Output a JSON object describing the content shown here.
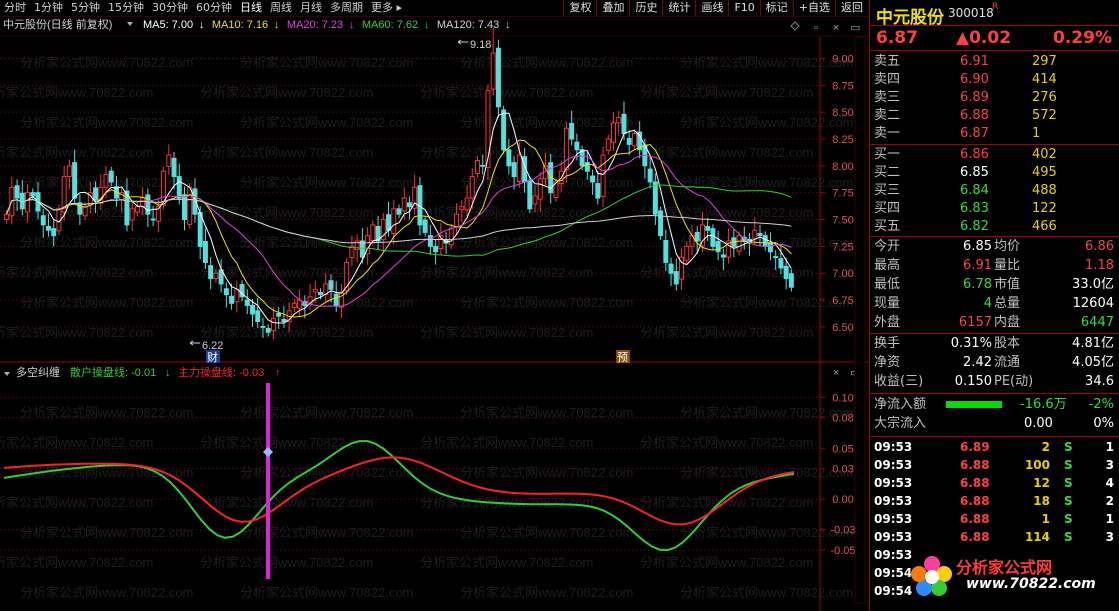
{
  "toolbar": {
    "periods": [
      "分时",
      "1分钟",
      "5分钟",
      "15分钟",
      "30分钟",
      "60分钟",
      "日线",
      "周线",
      "月线",
      "多周期",
      "更多 ▸"
    ],
    "active_period": "日线",
    "buttons": [
      "复权",
      "叠加",
      "历史",
      "统计",
      "画线",
      "F10",
      "标记",
      "+自选",
      "返回"
    ]
  },
  "main_chart": {
    "title": "中元股份(日线 前复权)",
    "ma_legend": [
      {
        "label": "MA5: 7.00",
        "arrow": "↓",
        "color": "#ffffff"
      },
      {
        "label": "MA10: 7.16",
        "arrow": "↓",
        "color": "#f0e000"
      },
      {
        "label": "MA20: 7.23",
        "arrow": "↓",
        "color": "#e040e0"
      },
      {
        "label": "MA60: 7.62",
        "arrow": "↓",
        "color": "#30d030"
      },
      {
        "label": "MA120: 7.43",
        "arrow": "↓",
        "color": "#d0d0d0"
      }
    ],
    "price_ticks": [
      "9.00",
      "8.75",
      "8.50",
      "8.25",
      "8.00",
      "7.75",
      "7.50",
      "7.25",
      "7.00",
      "6.75",
      "6.50"
    ],
    "high_marker": "9.18",
    "low_marker": "6.22",
    "marker_cai": "财",
    "marker_yu": "预",
    "watermark": "分析家公式网www.70822.com"
  },
  "indicator": {
    "title": "多空纠缠",
    "line1_label": "散户操盘线: -0.01",
    "line1_arrow": "↓",
    "line1_color": "#33cc33",
    "line2_label": "主力操盘线: -0.03",
    "line2_arrow": "↑",
    "line2_color": "#ff2020",
    "ticks": [
      "0.10",
      "0.08",
      "0.05",
      "0.03",
      "0.00",
      "-0.03",
      "-0.05"
    ]
  },
  "panel": {
    "name": "中元股份",
    "code": "300018",
    "code_badge": "R",
    "price": "6.87",
    "change": "▲0.02",
    "change_pct": "0.29%",
    "asks": [
      {
        "label": "卖五",
        "price": "6.91",
        "vol": "297"
      },
      {
        "label": "卖四",
        "price": "6.90",
        "vol": "414"
      },
      {
        "label": "卖三",
        "price": "6.89",
        "vol": "276"
      },
      {
        "label": "卖二",
        "price": "6.88",
        "vol": "572"
      },
      {
        "label": "卖一",
        "price": "6.87",
        "vol": "1"
      }
    ],
    "bids": [
      {
        "label": "买一",
        "price": "6.86",
        "vol": "402",
        "pcolor": "red"
      },
      {
        "label": "买二",
        "price": "6.85",
        "vol": "495",
        "pcolor": "wht"
      },
      {
        "label": "买三",
        "price": "6.84",
        "vol": "488",
        "pcolor": "grn"
      },
      {
        "label": "买四",
        "price": "6.83",
        "vol": "122",
        "pcolor": "grn"
      },
      {
        "label": "买五",
        "price": "6.82",
        "vol": "466",
        "pcolor": "grn"
      }
    ],
    "stats1": [
      {
        "l1": "今开",
        "v1": "6.85",
        "c1": "wht",
        "l2": "均价",
        "v2": "6.86",
        "c2": "red"
      },
      {
        "l1": "最高",
        "v1": "6.91",
        "c1": "red",
        "l2": "量比",
        "v2": "1.18",
        "c2": "red"
      },
      {
        "l1": "最低",
        "v1": "6.78",
        "c1": "grn",
        "l2": "市值",
        "v2": "33.0亿",
        "c2": "wht"
      },
      {
        "l1": "现量",
        "v1": "4",
        "c1": "grn",
        "l2": "总量",
        "v2": "12604",
        "c2": "wht"
      },
      {
        "l1": "外盘",
        "v1": "6157",
        "c1": "red",
        "l2": "内盘",
        "v2": "6447",
        "c2": "grn"
      }
    ],
    "stats2": [
      {
        "l1": "换手",
        "v1": "0.31%",
        "l2": "股本",
        "v2": "4.81亿"
      },
      {
        "l1": "净资",
        "v1": "2.42",
        "l2": "流通",
        "v2": "4.05亿"
      },
      {
        "l1": "收益(三)",
        "v1": "0.150",
        "l2": "PE(动)",
        "v2": "34.6"
      }
    ],
    "net_inflow_label": "净流入额",
    "net_inflow_value": "-16.6万",
    "net_inflow_pct": "-2%",
    "block_inflow_label": "大宗流入",
    "block_inflow_value": "0.00",
    "block_inflow_pct": "0%",
    "ticks": [
      {
        "time": "09:53",
        "price": "6.89",
        "vol": "2",
        "side": "S",
        "n": "1"
      },
      {
        "time": "09:53",
        "price": "6.88",
        "vol": "100",
        "side": "S",
        "n": "3"
      },
      {
        "time": "09:53",
        "price": "6.88",
        "vol": "12",
        "side": "S",
        "n": "4"
      },
      {
        "time": "09:53",
        "price": "6.88",
        "vol": "18",
        "side": "S",
        "n": "2"
      },
      {
        "time": "09:53",
        "price": "6.88",
        "vol": "1",
        "side": "S",
        "n": "1"
      },
      {
        "time": "09:53",
        "price": "6.88",
        "vol": "114",
        "side": "S",
        "n": "3"
      },
      {
        "time": "09:53",
        "price": "",
        "vol": "",
        "side": "",
        "n": ""
      },
      {
        "time": "09:54",
        "price": "",
        "vol": "",
        "side": "",
        "n": ""
      },
      {
        "time": "09:54",
        "price": "",
        "vol": "",
        "side": "",
        "n": ""
      }
    ],
    "logo_text": "分析家公式网",
    "logo_url": "www.70822.com"
  }
}
